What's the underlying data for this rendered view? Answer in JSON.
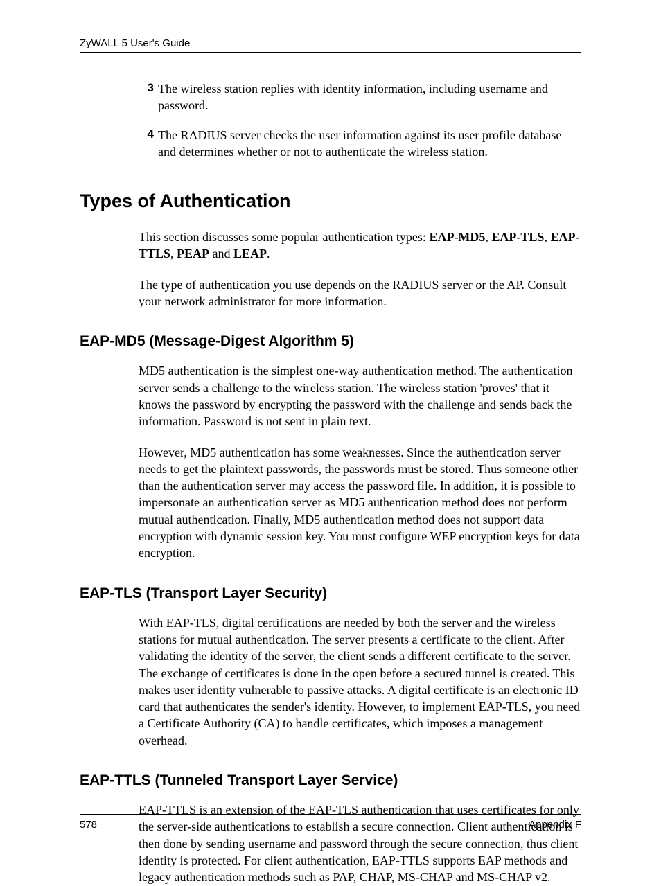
{
  "header": {
    "running": "ZyWALL 5 User's Guide"
  },
  "list": {
    "items": [
      {
        "num": "3",
        "text": "The wireless station replies with identity information, including username and password."
      },
      {
        "num": "4",
        "text": "The RADIUS server checks the user information against its user profile database and determines whether or not to authenticate the wireless station."
      }
    ]
  },
  "section": {
    "title": "Types of  Authentication",
    "intro_prefix": "This section discusses some popular authentication types: ",
    "types": {
      "t1": "EAP-MD5",
      "t2": "EAP-TLS",
      "t3": "EAP-TTLS",
      "t4": "PEAP",
      "t5": "LEAP"
    },
    "intro_sep1": ", ",
    "intro_sep2": ", ",
    "intro_sep3": ", ",
    "intro_and": " and ",
    "intro_period": ".",
    "intro2": "The type of authentication you use depends on the RADIUS server or the AP. Consult your network administrator for more information."
  },
  "md5": {
    "heading": "EAP-MD5 (Message-Digest Algorithm 5)",
    "p1": "MD5 authentication is the simplest one-way authentication method. The authentication server sends a challenge to the wireless station. The wireless station 'proves' that it knows the password by encrypting the password with the challenge and sends back the information. Password is not sent in plain text.",
    "p2": "However, MD5 authentication has some weaknesses. Since the authentication server needs to get the plaintext passwords, the passwords must be stored. Thus someone other than the authentication server may access the password file. In addition, it is possible to impersonate an authentication server as MD5 authentication method does not perform mutual authentication. Finally, MD5 authentication method does not support data encryption with dynamic session key. You must configure WEP encryption keys for data encryption."
  },
  "tls": {
    "heading": "EAP-TLS (Transport Layer Security)",
    "p1": "With EAP-TLS, digital certifications are needed by both the server and the wireless stations for mutual authentication. The server presents a certificate to the client. After validating the identity of the server, the client sends a different certificate to the server. The exchange of certificates is done in the open before a secured tunnel is created. This makes user identity vulnerable to passive attacks. A digital certificate is an electronic ID card that authenticates the sender's identity. However, to implement EAP-TLS, you need a Certificate Authority (CA) to handle certificates, which imposes a management overhead."
  },
  "ttls": {
    "heading": "EAP-TTLS (Tunneled Transport Layer Service)",
    "p1": "EAP-TTLS is an extension of the EAP-TLS authentication that uses certificates for only the server-side authentications to establish a secure connection. Client authentication is then done by sending username and password through the secure connection, thus client identity is protected. For client authentication, EAP-TTLS supports EAP methods and legacy authentication methods such as PAP, CHAP, MS-CHAP and MS-CHAP v2."
  },
  "footer": {
    "page": "578",
    "appendix": "Appendix F"
  }
}
